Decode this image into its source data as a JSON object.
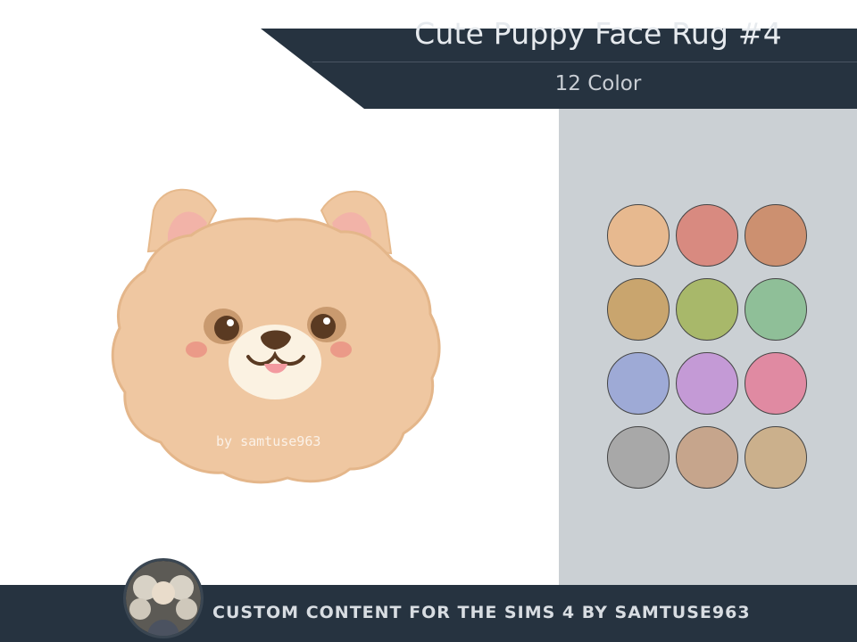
{
  "header": {
    "title": "Cute Puppy Face Rug #4",
    "subtitle": "12 Color",
    "background": "#263340"
  },
  "rug": {
    "watermark": "by samtuse963",
    "base_color": "#f0c9a0"
  },
  "swatches": [
    {
      "color": "#e7b98f"
    },
    {
      "color": "#d88a80"
    },
    {
      "color": "#cc9070"
    },
    {
      "color": "#c9a56e"
    },
    {
      "color": "#a8b86a"
    },
    {
      "color": "#8fbf98"
    },
    {
      "color": "#9eaad6"
    },
    {
      "color": "#c49ad6"
    },
    {
      "color": "#e08aa2"
    },
    {
      "color": "#a8a8a8"
    },
    {
      "color": "#c6a58c"
    },
    {
      "color": "#cbb08c"
    }
  ],
  "footer": {
    "text": "CUSTOM CONTENT FOR THE SIMS 4 BY SAMTUSE963",
    "avatar_icon": "doll-portrait-icon"
  }
}
